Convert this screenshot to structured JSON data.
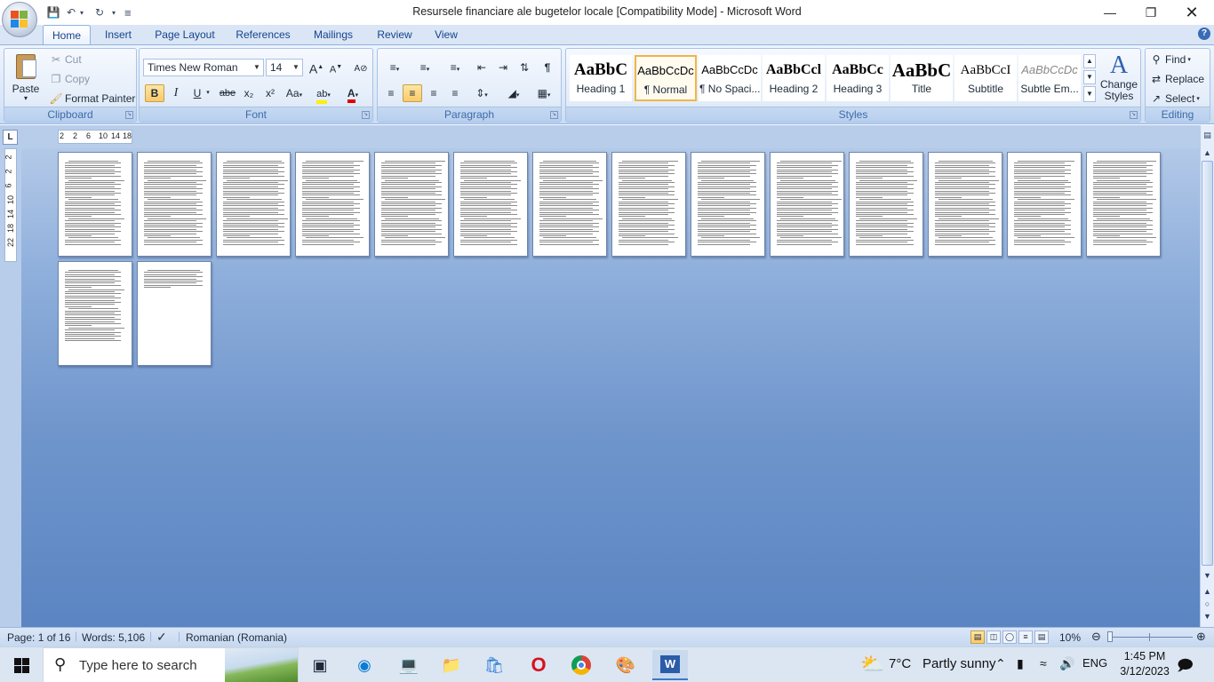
{
  "window": {
    "title": "Resursele financiare ale bugetelor locale [Compatibility Mode] - Microsoft Word",
    "controls": [
      "minimize",
      "restore",
      "close"
    ]
  },
  "quick_access": {
    "undo_icon": "undo-icon",
    "redo_icon": "redo-icon",
    "save_icon": "save-icon"
  },
  "ribbon": {
    "tabs": [
      "Home",
      "Insert",
      "Page Layout",
      "References",
      "Mailings",
      "Review",
      "View"
    ],
    "active_tab": "Home",
    "clipboard": {
      "label": "Clipboard",
      "paste": "Paste",
      "cut": "Cut",
      "copy": "Copy",
      "format_painter": "Format Painter"
    },
    "font": {
      "label": "Font",
      "family": "Times New Roman",
      "size": "14",
      "grow": "A",
      "shrink": "A",
      "bold": "B",
      "italic": "I",
      "underline": "U",
      "strike": "abe",
      "subscript": "x₂",
      "superscript": "x²",
      "change_case": "Aa",
      "highlight": "ab",
      "font_color": "A"
    },
    "paragraph": {
      "label": "Paragraph"
    },
    "styles": {
      "label": "Styles",
      "items": [
        {
          "preview": "AaBbC",
          "name": "Heading 1"
        },
        {
          "preview": "AaBbCcDc",
          "name": "¶ Normal"
        },
        {
          "preview": "AaBbCcDc",
          "name": "¶ No Spaci..."
        },
        {
          "preview": "AaBbCcl",
          "name": "Heading 2"
        },
        {
          "preview": "AaBbCc",
          "name": "Heading 3"
        },
        {
          "preview": "AaBbC",
          "name": "Title"
        },
        {
          "preview": "AaBbCcI",
          "name": "Subtitle"
        },
        {
          "preview": "AaBbCcDc",
          "name": "Subtle Em..."
        }
      ],
      "selected_index": 1,
      "change_styles": "Change Styles"
    },
    "editing": {
      "label": "Editing",
      "find": "Find",
      "replace": "Replace",
      "select": "Select"
    }
  },
  "ruler": {
    "tab_selector": "L",
    "h_labels": [
      "2",
      "2",
      "6",
      "10",
      "14",
      "18"
    ],
    "v_labels": [
      "2",
      "2",
      "6",
      "10",
      "14",
      "18",
      "22"
    ]
  },
  "document": {
    "page_count": 16
  },
  "status": {
    "page": "Page: 1 of 16",
    "words": "Words: 5,106",
    "language": "Romanian (Romania)",
    "zoom": "10%"
  },
  "taskbar": {
    "search_placeholder": "Type here to search",
    "weather_temp": "7°C",
    "weather_text": "Partly sunny",
    "lang": "ENG",
    "time": "1:45 PM",
    "date": "3/12/2023"
  },
  "colors": {
    "ribbon_bg": "#dbe7f7",
    "doc_bg": "#6f95cc",
    "accent": "#15428b"
  }
}
